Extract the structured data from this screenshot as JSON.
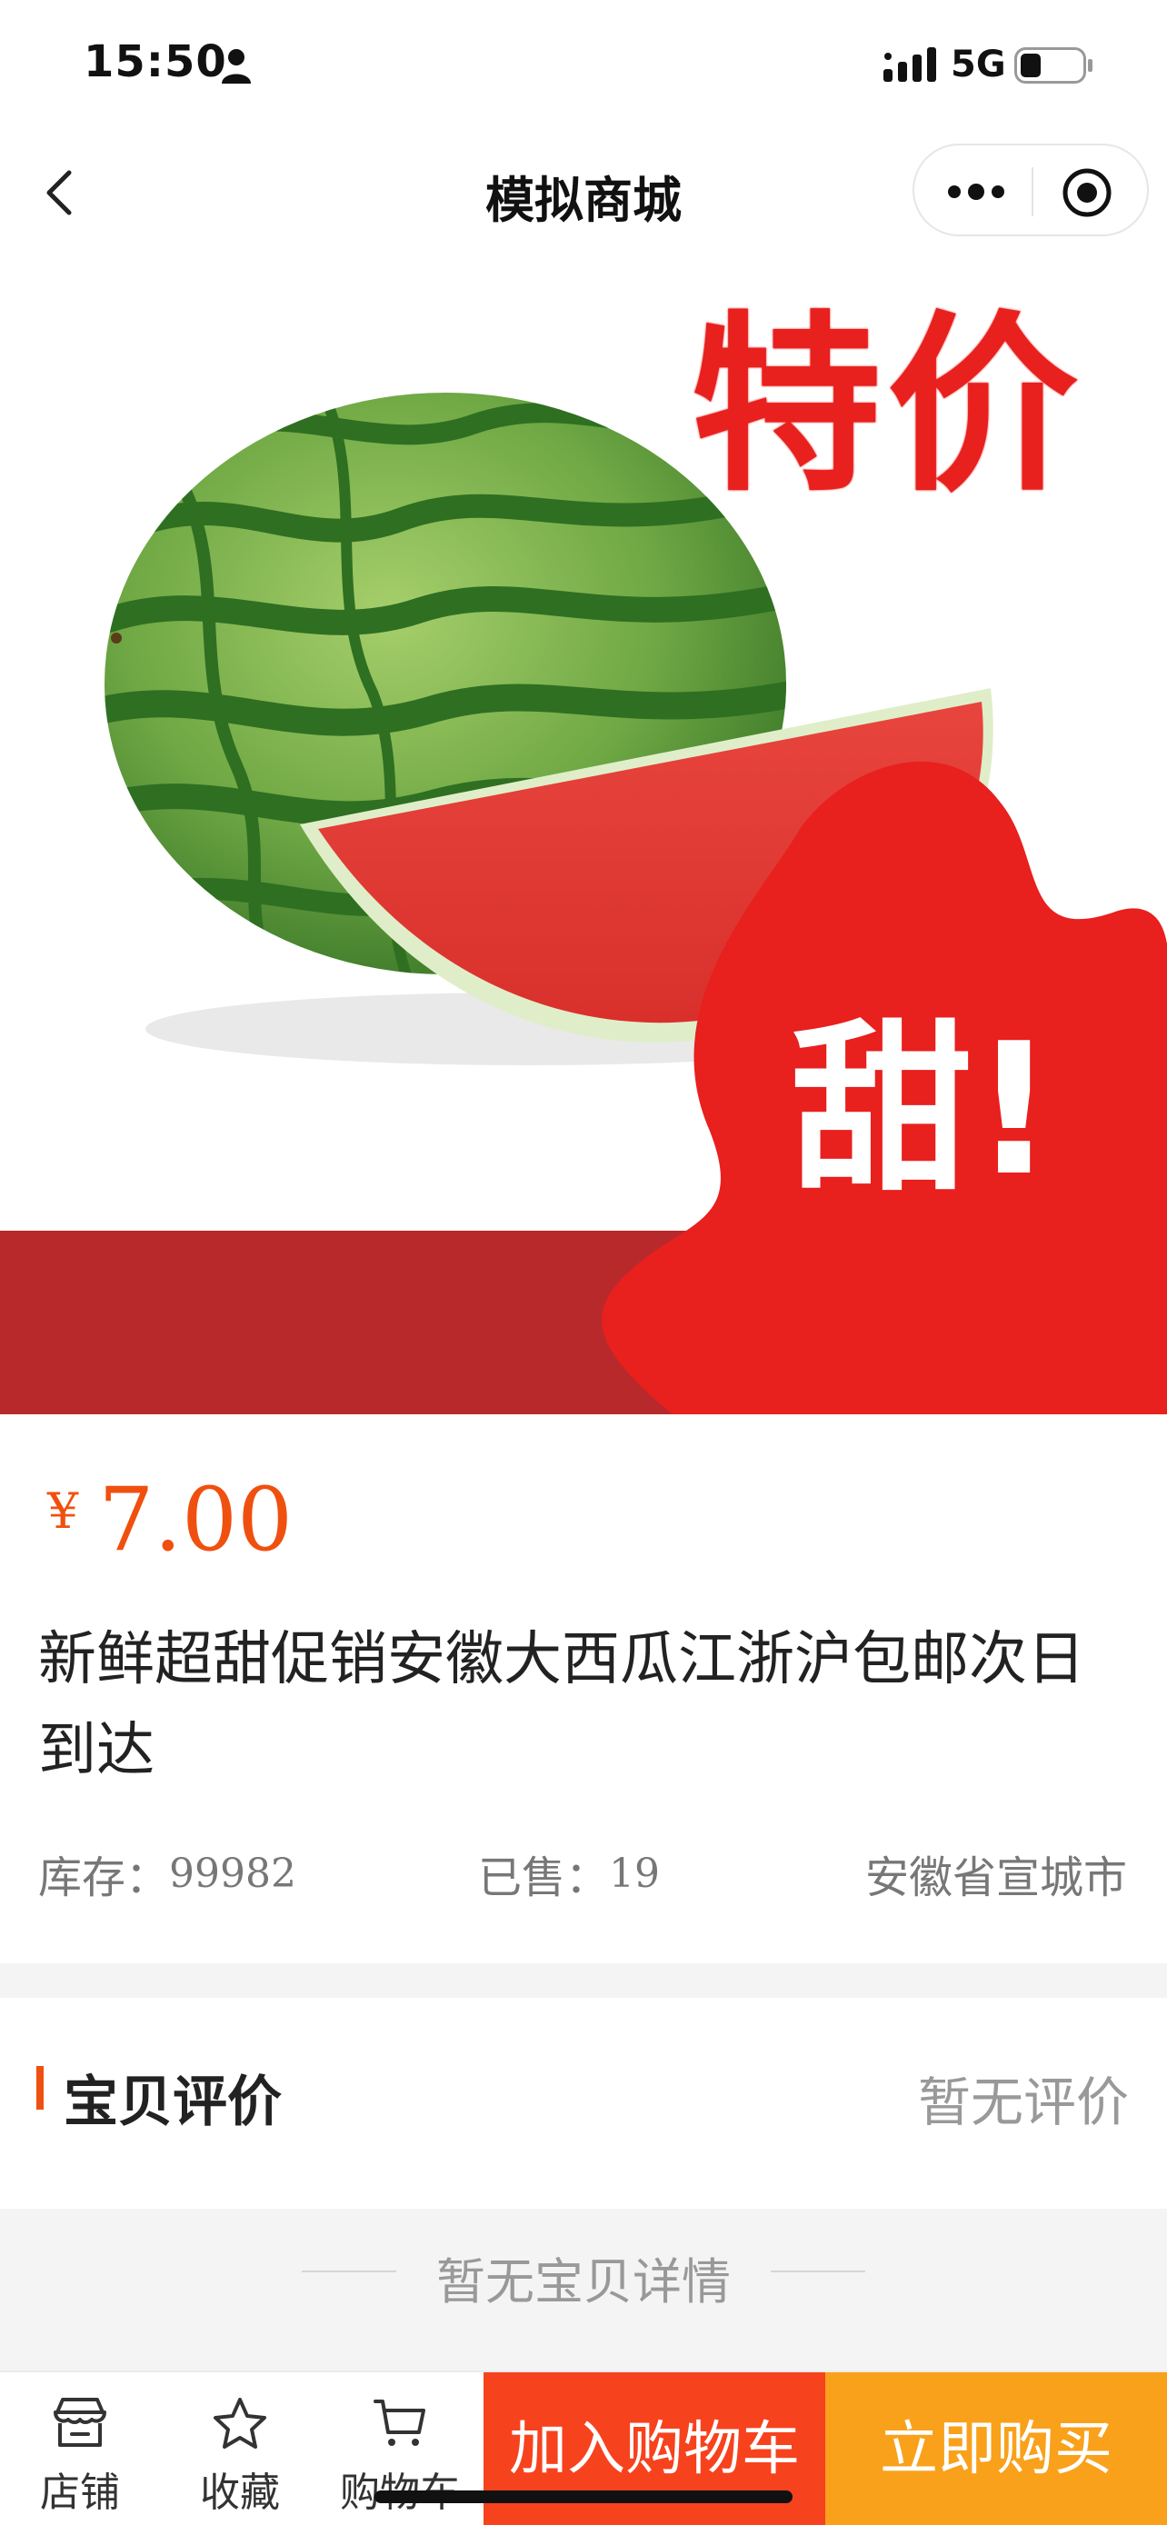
{
  "status_bar": {
    "time": "15:50",
    "network": "5G",
    "icons": [
      "person-icon",
      "signal-icon",
      "battery-icon"
    ]
  },
  "nav": {
    "title": "模拟商城",
    "icons": [
      "back-icon",
      "more-icon",
      "target-icon"
    ]
  },
  "product_image": {
    "badge_top": "特价",
    "badge_bottom": "甜!",
    "colors": {
      "accent_red": "#e8201e",
      "band_red": "#b8292c"
    }
  },
  "product": {
    "currency": "¥",
    "price": "7.00",
    "title": "新鲜超甜促销安徽大西瓜江浙沪包邮次日到达",
    "stock_label": "库存：",
    "stock_value": "99982",
    "sold_label": "已售：",
    "sold_value": "19",
    "region": "安徽省宣城市"
  },
  "reviews": {
    "title": "宝贝评价",
    "empty_text": "暂无评价"
  },
  "details": {
    "empty_text": "暂无宝贝详情"
  },
  "bottom_bar": {
    "tabs": [
      {
        "label": "店铺",
        "icon": "shop-icon"
      },
      {
        "label": "收藏",
        "icon": "star-icon"
      },
      {
        "label": "购物车",
        "icon": "cart-icon"
      }
    ],
    "add_to_cart": "加入购物车",
    "buy_now": "立即购买",
    "colors": {
      "add_to_cart": "#f7421e",
      "buy_now": "#f9a11b",
      "price": "#f0500f"
    }
  }
}
